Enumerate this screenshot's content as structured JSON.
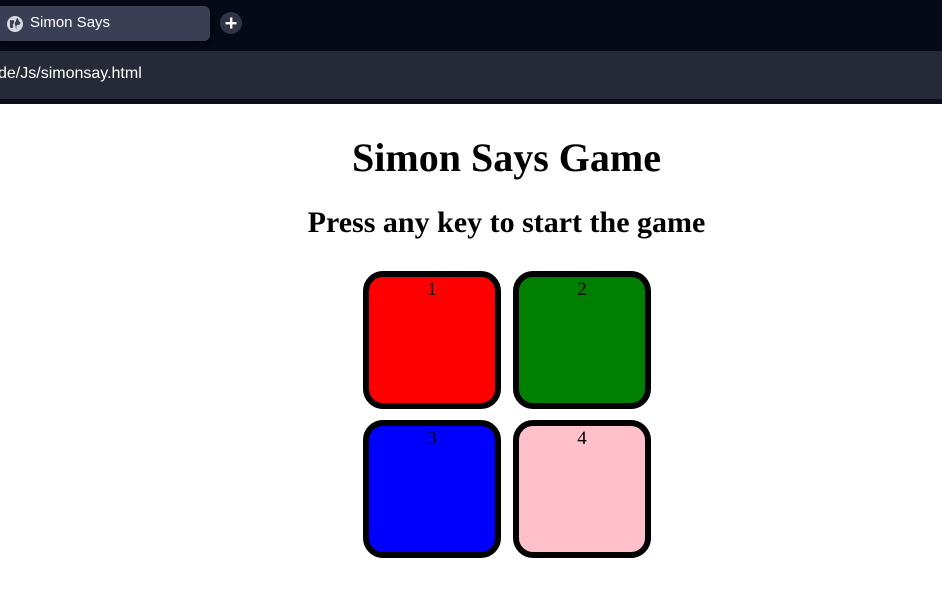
{
  "browser": {
    "tab_title": "Simon Says",
    "url": "de/Js/simonsay.html"
  },
  "page": {
    "title": "Simon Says Game",
    "subtitle": "Press any key to start the game"
  },
  "buttons": [
    {
      "label": "1",
      "color": "#ff0000",
      "icon": "red-pad"
    },
    {
      "label": "2",
      "color": "#008000",
      "icon": "green-pad"
    },
    {
      "label": "3",
      "color": "#0000ff",
      "icon": "blue-pad"
    },
    {
      "label": "4",
      "color": "#ffc0cb",
      "icon": "pink-pad"
    }
  ]
}
